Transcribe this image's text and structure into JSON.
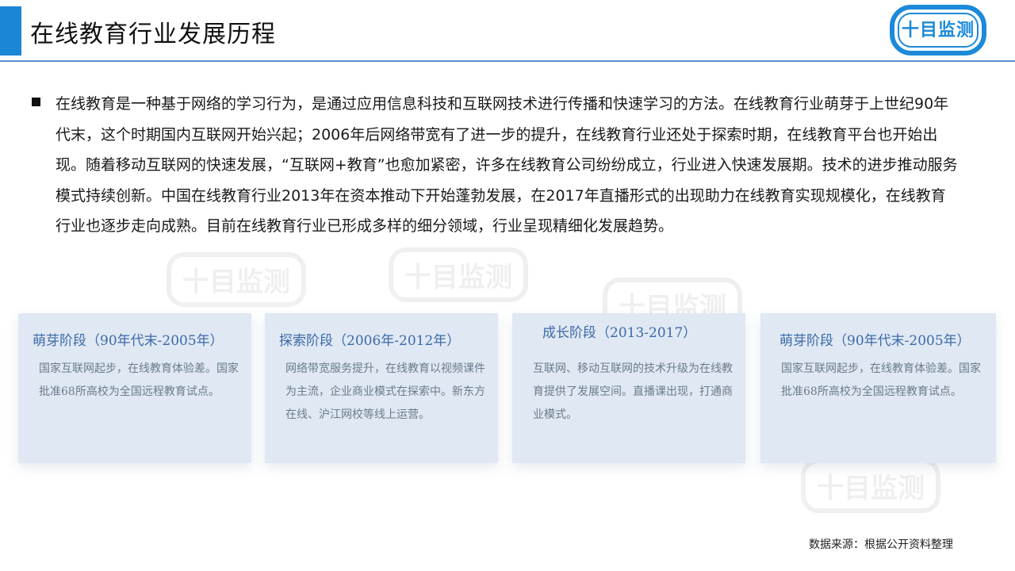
{
  "header": {
    "title": "在线教育行业发展历程",
    "logo_text": "十目监测",
    "accent_color": "#1a86d6",
    "rule_color": "#5b8fd0"
  },
  "intro": {
    "paragraph": "在线教育是一种基于网络的学习行为，是通过应用信息科技和互联网技术进行传播和快速学习的方法。在线教育行业萌芽于上世纪90年代末，这个时期国内互联网开始兴起；2006年后网络带宽有了进一步的提升，在线教育行业还处于探索时期，在线教育平台也开始出现。随着移动互联网的快速发展，“互联网+教育”也愈加紧密，许多在线教育公司纷纷成立，行业进入快速发展期。技术的进步推动服务模式持续创新。中国在线教育行业2013年在资本推动下开始蓬勃发展，在2017年直播形式的出现助力在线教育实现规模化，在线教育行业也逐步走向成熟。目前在线教育行业已形成多样的细分领域，行业呈现精细化发展趋势。"
  },
  "cards": [
    {
      "title": "萌芽阶段（90年代末-2005年）",
      "desc": "国家互联网起步，在线教育体验差。国家批准68所高校为全国远程教育试点。"
    },
    {
      "title": "探索阶段（2006年-2012年）",
      "desc": "网络带宽服务提升，在线教育以视频课件为主流，企业商业模式在探索中。新东方在线、沪江网校等线上运营。"
    },
    {
      "title": "成长阶段（2013-2017）",
      "desc": "互联网、移动互联网的技术升级为在线教育提供了发展空间。直播课出现，打通商业模式。"
    },
    {
      "title": "萌芽阶段（90年代末-2005年）",
      "desc": "国家互联网起步，在线教育体验差。国家批准68所高校为全国远程教育试点。"
    }
  ],
  "footer": {
    "source": "数据来源：根据公开资料整理"
  }
}
